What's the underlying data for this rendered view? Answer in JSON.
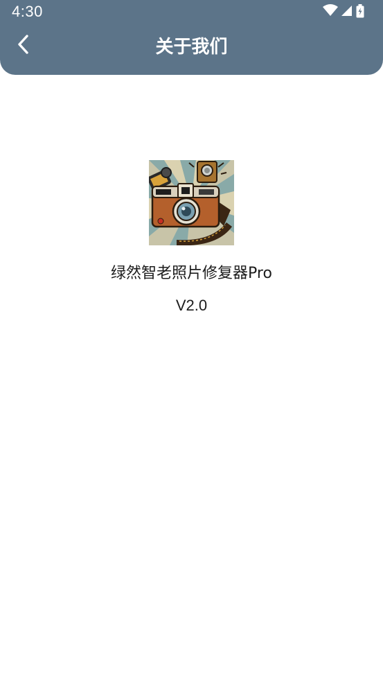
{
  "status_bar": {
    "time": "4:30",
    "icons": [
      "wifi-icon",
      "signal-icon",
      "battery-icon"
    ]
  },
  "header": {
    "title": "关于我们",
    "back_icon": "chevron-left-icon",
    "background": "#5c7489"
  },
  "about": {
    "logo_icon": "vintage-camera-logo",
    "app_name": "绿然智老照片修复器Pro",
    "version": "V2.0"
  }
}
